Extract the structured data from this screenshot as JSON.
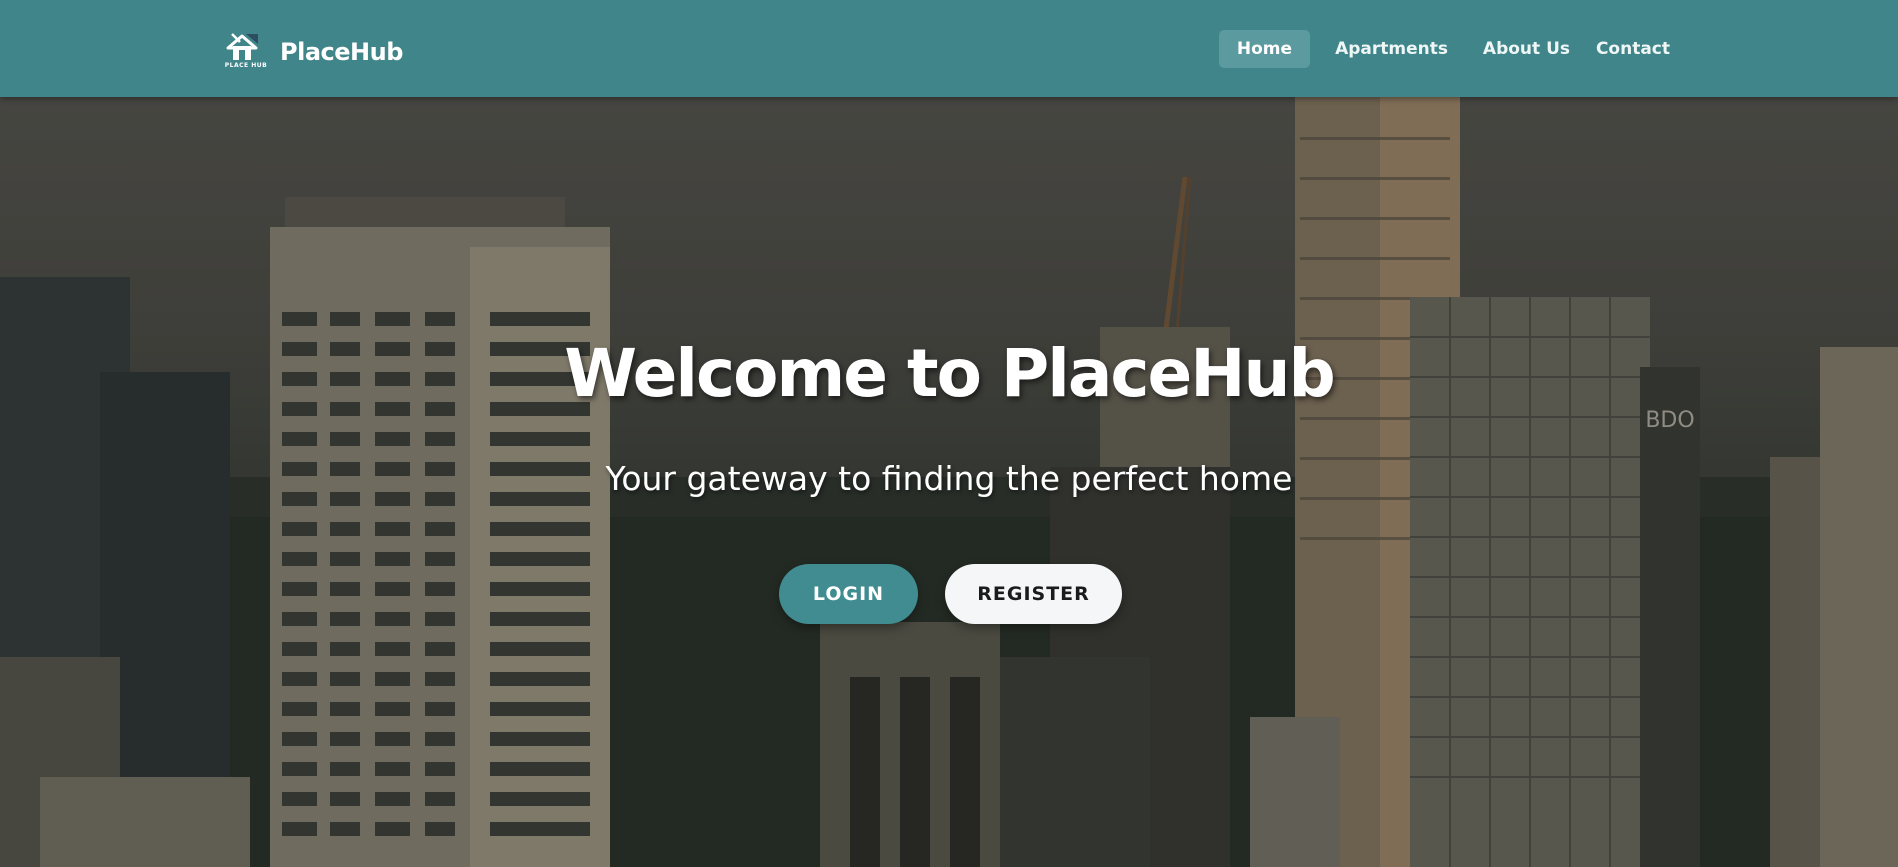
{
  "brand": {
    "name": "PlaceHub",
    "logo_caption": "PLACE HUB",
    "logo_icon": "house-icon"
  },
  "nav": {
    "items": [
      {
        "label": "Home",
        "active": true
      },
      {
        "label": "Apartments",
        "active": false
      },
      {
        "label": "About Us",
        "active": false
      },
      {
        "label": "Contact",
        "active": false
      }
    ]
  },
  "hero": {
    "title": "Welcome to PlaceHub",
    "subtitle": "Your gateway to finding the perfect home",
    "login_label": "LOGIN",
    "register_label": "REGISTER",
    "sign_text": "BDO"
  },
  "colors": {
    "navbar": "#40858a",
    "nav_active": "#5b9a9e",
    "login_button": "#418c91",
    "register_button": "#f5f6f8"
  }
}
